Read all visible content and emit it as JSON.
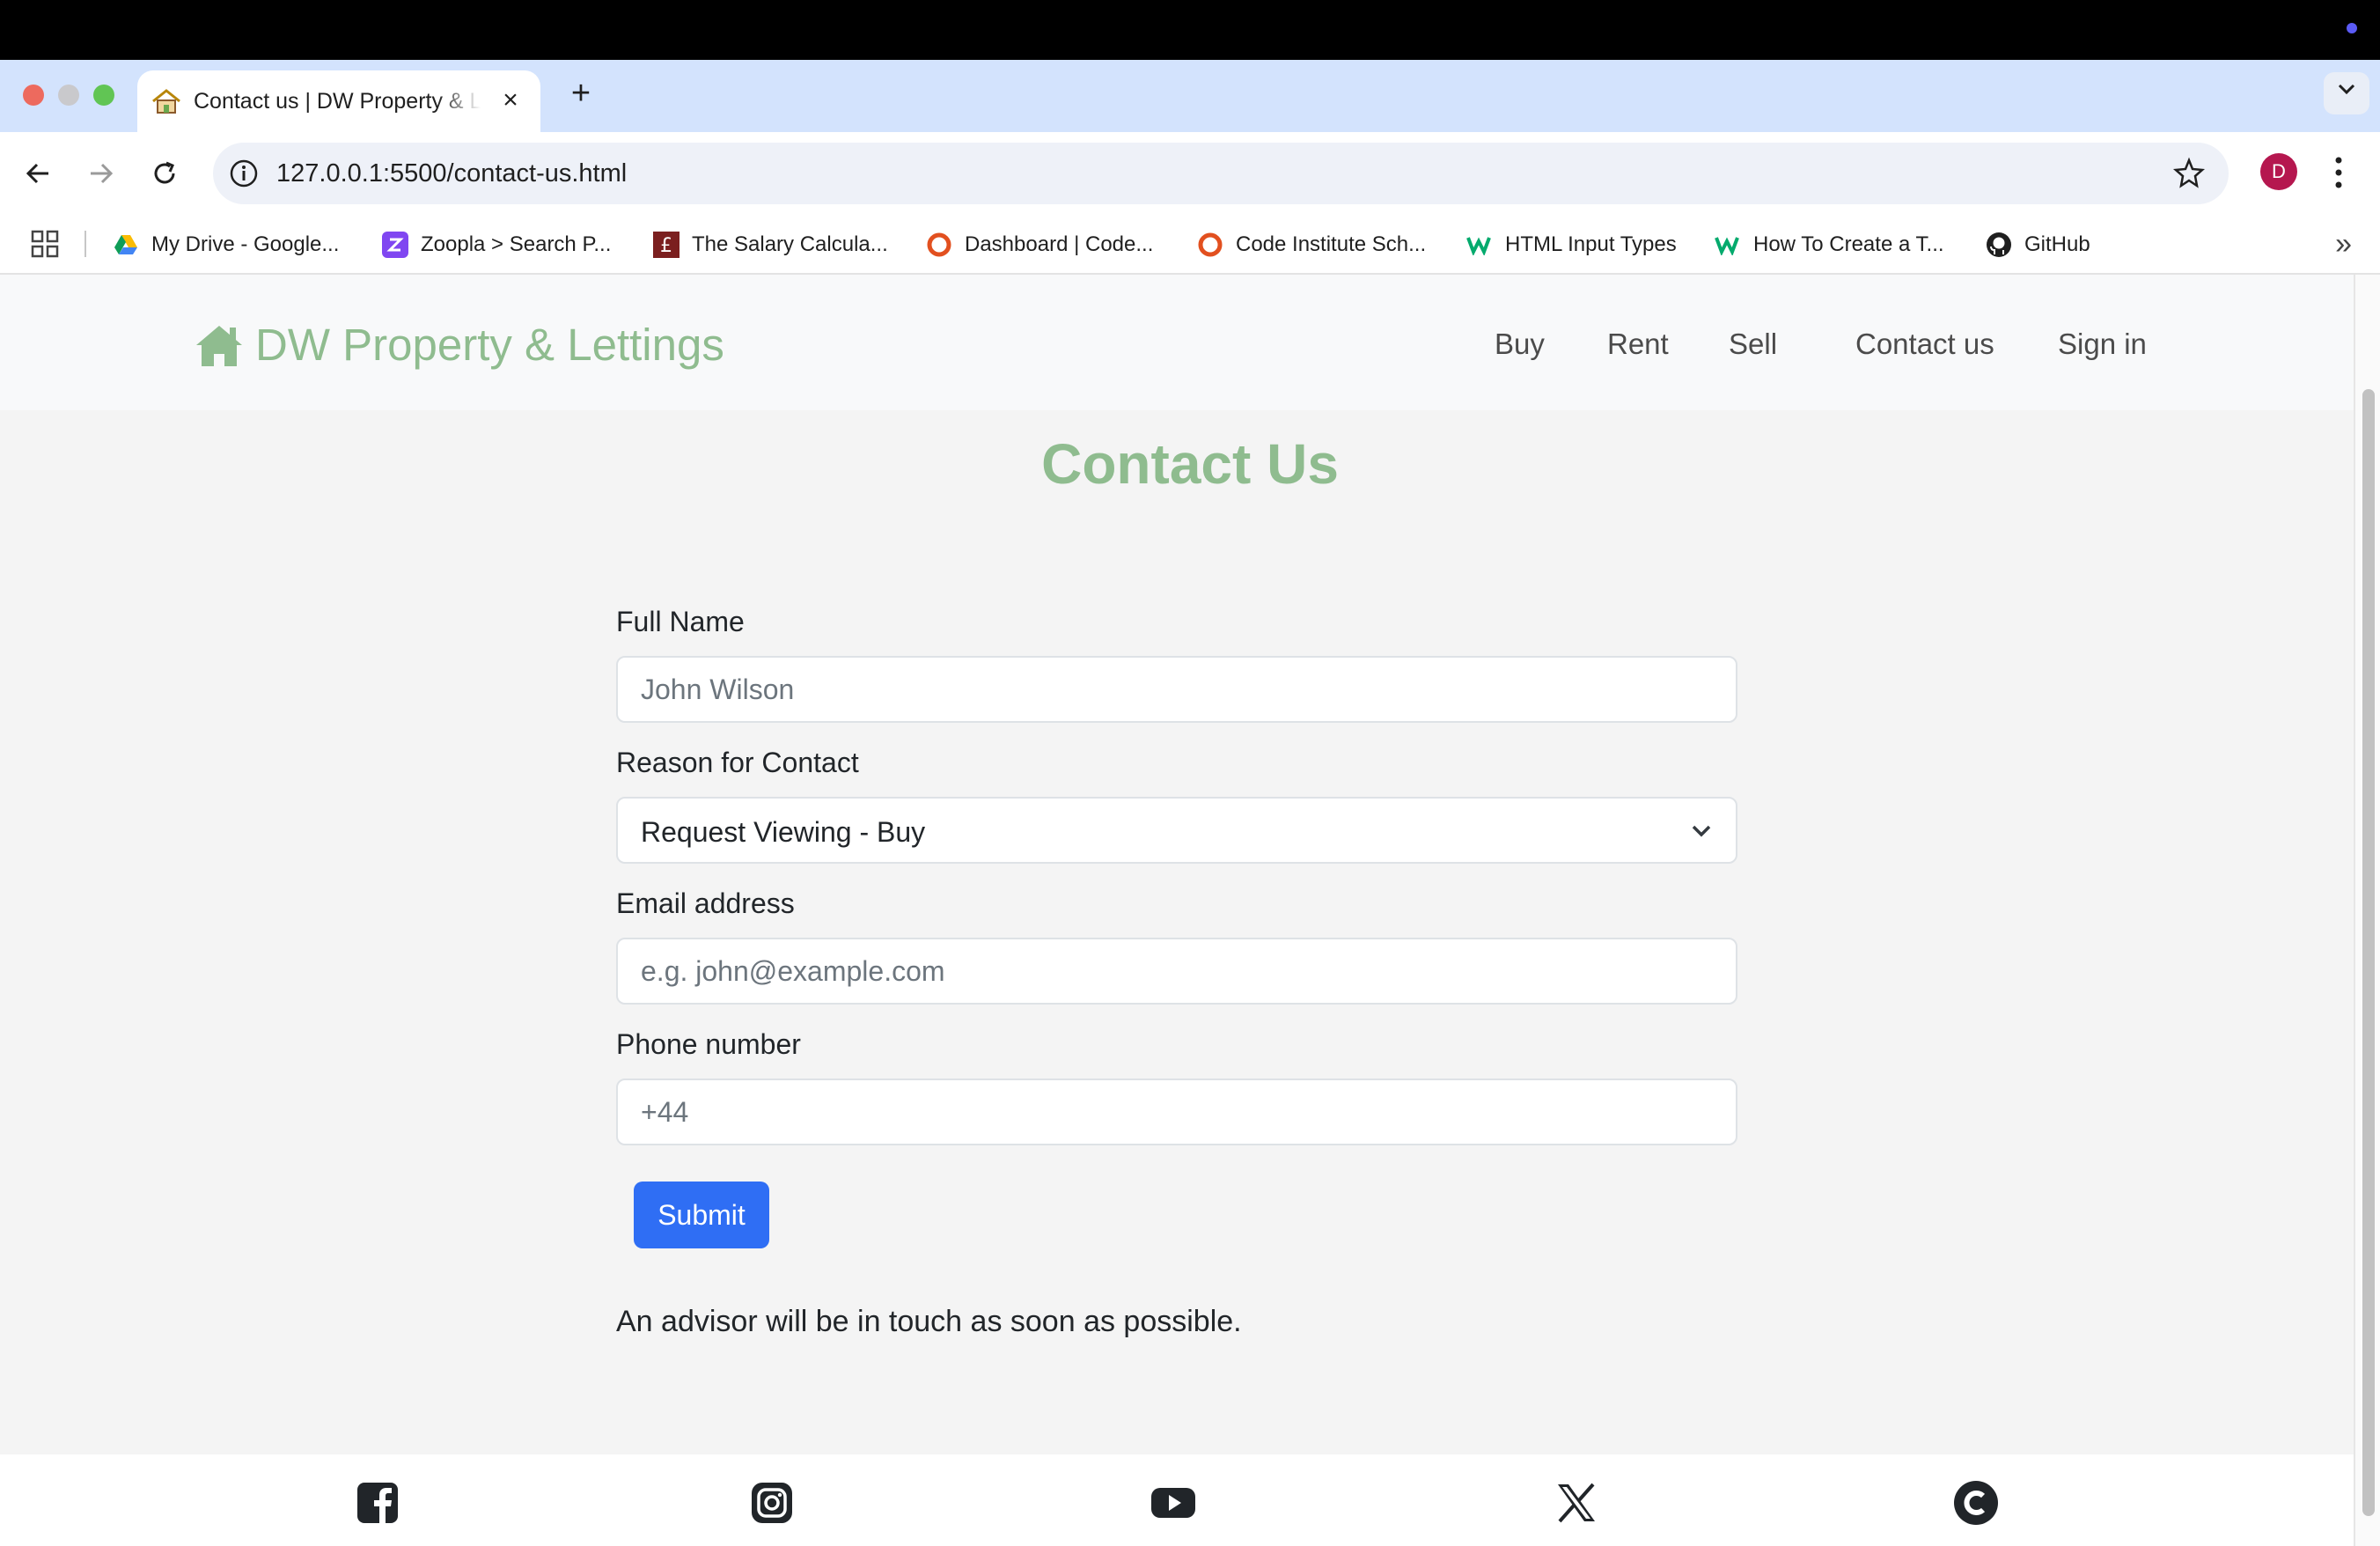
{
  "browser": {
    "tab_title": "Contact us | DW Property & Lettings",
    "address": "127.0.0.1:5500/contact-us.html",
    "profile_initial": "D",
    "bookmarks": [
      {
        "label": "My Drive - Google...",
        "icon": "google-drive-icon"
      },
      {
        "label": "Zoopla > Search P...",
        "icon": "zoopla-icon"
      },
      {
        "label": "The Salary Calcula...",
        "icon": "pound-icon"
      },
      {
        "label": "Dashboard | Code...",
        "icon": "code-institute-icon"
      },
      {
        "label": "Code Institute Sch...",
        "icon": "code-institute-icon"
      },
      {
        "label": "HTML Input Types",
        "icon": "w3schools-icon"
      },
      {
        "label": "How To Create a T...",
        "icon": "w3schools-icon"
      },
      {
        "label": "GitHub",
        "icon": "github-icon"
      }
    ]
  },
  "site": {
    "brand": "DW Property & Lettings",
    "nav": [
      "Buy",
      "Rent",
      "Sell",
      "Contact us",
      "Sign in"
    ],
    "brand_color": "#8fbc8f"
  },
  "form": {
    "title": "Contact Us",
    "name_label": "Full Name",
    "name_placeholder": "John Wilson",
    "reason_label": "Reason for Contact",
    "reason_value": "Request Viewing - Buy",
    "email_label": "Email address",
    "email_placeholder": "e.g. john@example.com",
    "phone_label": "Phone number",
    "phone_placeholder": "+44",
    "submit_label": "Submit",
    "submit_color": "#2f6ef4",
    "note": "An advisor will be in touch as soon as possible."
  },
  "footer": {
    "social_icons": [
      "facebook-icon",
      "instagram-icon",
      "youtube-icon",
      "x-icon",
      "copyright-icon"
    ]
  }
}
